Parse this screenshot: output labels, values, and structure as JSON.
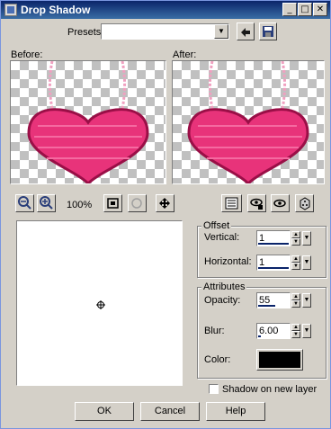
{
  "window": {
    "title": "Drop Shadow"
  },
  "titlebar_buttons": {
    "minimize": "_",
    "maximize": "□",
    "close": "✕"
  },
  "presets": {
    "label": "Presets:",
    "value": ""
  },
  "preview": {
    "before_label": "Before:",
    "after_label": "After:"
  },
  "toolbar": {
    "zoom": "100%"
  },
  "offset": {
    "title": "Offset",
    "vertical_label": "Vertical:",
    "vertical_value": "1",
    "horizontal_label": "Horizontal:",
    "horizontal_value": "1"
  },
  "attributes": {
    "title": "Attributes",
    "opacity_label": "Opacity:",
    "opacity_value": "55",
    "blur_label": "Blur:",
    "blur_value": "6.00",
    "color_label": "Color:",
    "color": "#000000"
  },
  "shadow_on_new_layer": {
    "label": "Shadow on new layer",
    "checked": false
  },
  "buttons": {
    "ok": "OK",
    "cancel": "Cancel",
    "help": "Help"
  },
  "colors": {
    "title_start": "#0a246a",
    "title_end": "#3a6ea5",
    "heart": "#e8337a",
    "dialog_bg": "#d4d0c8"
  }
}
